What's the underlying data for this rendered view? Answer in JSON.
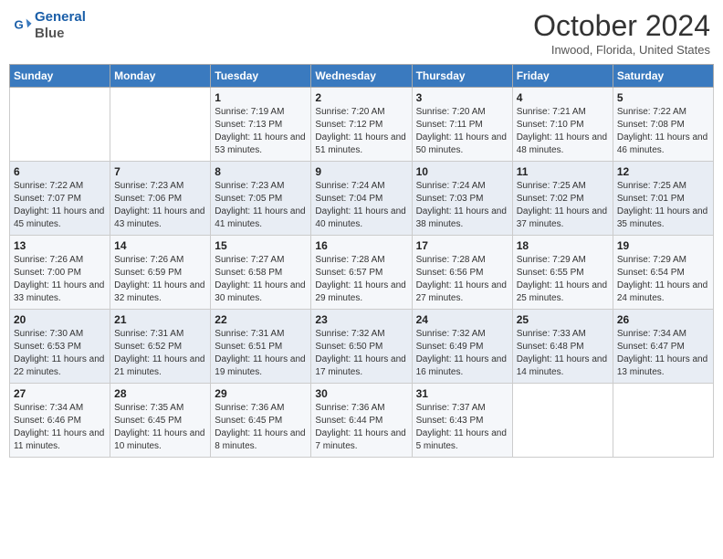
{
  "header": {
    "logo_line1": "General",
    "logo_line2": "Blue",
    "month": "October 2024",
    "location": "Inwood, Florida, United States"
  },
  "days_of_week": [
    "Sunday",
    "Monday",
    "Tuesday",
    "Wednesday",
    "Thursday",
    "Friday",
    "Saturday"
  ],
  "weeks": [
    [
      {
        "day": "",
        "sunrise": "",
        "sunset": "",
        "daylight": ""
      },
      {
        "day": "",
        "sunrise": "",
        "sunset": "",
        "daylight": ""
      },
      {
        "day": "1",
        "sunrise": "Sunrise: 7:19 AM",
        "sunset": "Sunset: 7:13 PM",
        "daylight": "Daylight: 11 hours and 53 minutes."
      },
      {
        "day": "2",
        "sunrise": "Sunrise: 7:20 AM",
        "sunset": "Sunset: 7:12 PM",
        "daylight": "Daylight: 11 hours and 51 minutes."
      },
      {
        "day": "3",
        "sunrise": "Sunrise: 7:20 AM",
        "sunset": "Sunset: 7:11 PM",
        "daylight": "Daylight: 11 hours and 50 minutes."
      },
      {
        "day": "4",
        "sunrise": "Sunrise: 7:21 AM",
        "sunset": "Sunset: 7:10 PM",
        "daylight": "Daylight: 11 hours and 48 minutes."
      },
      {
        "day": "5",
        "sunrise": "Sunrise: 7:22 AM",
        "sunset": "Sunset: 7:08 PM",
        "daylight": "Daylight: 11 hours and 46 minutes."
      }
    ],
    [
      {
        "day": "6",
        "sunrise": "Sunrise: 7:22 AM",
        "sunset": "Sunset: 7:07 PM",
        "daylight": "Daylight: 11 hours and 45 minutes."
      },
      {
        "day": "7",
        "sunrise": "Sunrise: 7:23 AM",
        "sunset": "Sunset: 7:06 PM",
        "daylight": "Daylight: 11 hours and 43 minutes."
      },
      {
        "day": "8",
        "sunrise": "Sunrise: 7:23 AM",
        "sunset": "Sunset: 7:05 PM",
        "daylight": "Daylight: 11 hours and 41 minutes."
      },
      {
        "day": "9",
        "sunrise": "Sunrise: 7:24 AM",
        "sunset": "Sunset: 7:04 PM",
        "daylight": "Daylight: 11 hours and 40 minutes."
      },
      {
        "day": "10",
        "sunrise": "Sunrise: 7:24 AM",
        "sunset": "Sunset: 7:03 PM",
        "daylight": "Daylight: 11 hours and 38 minutes."
      },
      {
        "day": "11",
        "sunrise": "Sunrise: 7:25 AM",
        "sunset": "Sunset: 7:02 PM",
        "daylight": "Daylight: 11 hours and 37 minutes."
      },
      {
        "day": "12",
        "sunrise": "Sunrise: 7:25 AM",
        "sunset": "Sunset: 7:01 PM",
        "daylight": "Daylight: 11 hours and 35 minutes."
      }
    ],
    [
      {
        "day": "13",
        "sunrise": "Sunrise: 7:26 AM",
        "sunset": "Sunset: 7:00 PM",
        "daylight": "Daylight: 11 hours and 33 minutes."
      },
      {
        "day": "14",
        "sunrise": "Sunrise: 7:26 AM",
        "sunset": "Sunset: 6:59 PM",
        "daylight": "Daylight: 11 hours and 32 minutes."
      },
      {
        "day": "15",
        "sunrise": "Sunrise: 7:27 AM",
        "sunset": "Sunset: 6:58 PM",
        "daylight": "Daylight: 11 hours and 30 minutes."
      },
      {
        "day": "16",
        "sunrise": "Sunrise: 7:28 AM",
        "sunset": "Sunset: 6:57 PM",
        "daylight": "Daylight: 11 hours and 29 minutes."
      },
      {
        "day": "17",
        "sunrise": "Sunrise: 7:28 AM",
        "sunset": "Sunset: 6:56 PM",
        "daylight": "Daylight: 11 hours and 27 minutes."
      },
      {
        "day": "18",
        "sunrise": "Sunrise: 7:29 AM",
        "sunset": "Sunset: 6:55 PM",
        "daylight": "Daylight: 11 hours and 25 minutes."
      },
      {
        "day": "19",
        "sunrise": "Sunrise: 7:29 AM",
        "sunset": "Sunset: 6:54 PM",
        "daylight": "Daylight: 11 hours and 24 minutes."
      }
    ],
    [
      {
        "day": "20",
        "sunrise": "Sunrise: 7:30 AM",
        "sunset": "Sunset: 6:53 PM",
        "daylight": "Daylight: 11 hours and 22 minutes."
      },
      {
        "day": "21",
        "sunrise": "Sunrise: 7:31 AM",
        "sunset": "Sunset: 6:52 PM",
        "daylight": "Daylight: 11 hours and 21 minutes."
      },
      {
        "day": "22",
        "sunrise": "Sunrise: 7:31 AM",
        "sunset": "Sunset: 6:51 PM",
        "daylight": "Daylight: 11 hours and 19 minutes."
      },
      {
        "day": "23",
        "sunrise": "Sunrise: 7:32 AM",
        "sunset": "Sunset: 6:50 PM",
        "daylight": "Daylight: 11 hours and 17 minutes."
      },
      {
        "day": "24",
        "sunrise": "Sunrise: 7:32 AM",
        "sunset": "Sunset: 6:49 PM",
        "daylight": "Daylight: 11 hours and 16 minutes."
      },
      {
        "day": "25",
        "sunrise": "Sunrise: 7:33 AM",
        "sunset": "Sunset: 6:48 PM",
        "daylight": "Daylight: 11 hours and 14 minutes."
      },
      {
        "day": "26",
        "sunrise": "Sunrise: 7:34 AM",
        "sunset": "Sunset: 6:47 PM",
        "daylight": "Daylight: 11 hours and 13 minutes."
      }
    ],
    [
      {
        "day": "27",
        "sunrise": "Sunrise: 7:34 AM",
        "sunset": "Sunset: 6:46 PM",
        "daylight": "Daylight: 11 hours and 11 minutes."
      },
      {
        "day": "28",
        "sunrise": "Sunrise: 7:35 AM",
        "sunset": "Sunset: 6:45 PM",
        "daylight": "Daylight: 11 hours and 10 minutes."
      },
      {
        "day": "29",
        "sunrise": "Sunrise: 7:36 AM",
        "sunset": "Sunset: 6:45 PM",
        "daylight": "Daylight: 11 hours and 8 minutes."
      },
      {
        "day": "30",
        "sunrise": "Sunrise: 7:36 AM",
        "sunset": "Sunset: 6:44 PM",
        "daylight": "Daylight: 11 hours and 7 minutes."
      },
      {
        "day": "31",
        "sunrise": "Sunrise: 7:37 AM",
        "sunset": "Sunset: 6:43 PM",
        "daylight": "Daylight: 11 hours and 5 minutes."
      },
      {
        "day": "",
        "sunrise": "",
        "sunset": "",
        "daylight": ""
      },
      {
        "day": "",
        "sunrise": "",
        "sunset": "",
        "daylight": ""
      }
    ]
  ]
}
